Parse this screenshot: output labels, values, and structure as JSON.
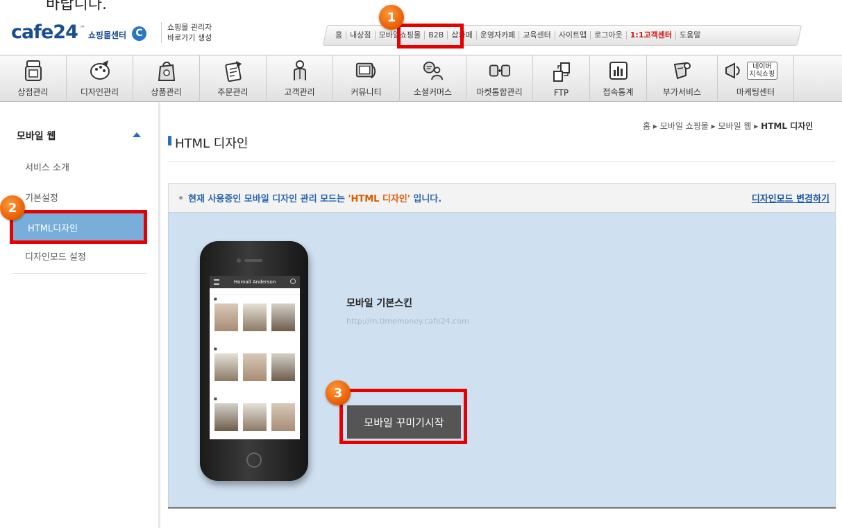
{
  "caption": "바랍니다.",
  "header": {
    "logo_text": "cafe24",
    "logo_tm": "™",
    "logo_sub": "쇼핑몰센터",
    "logo_c": "C",
    "admin_shortcut_line1": "쇼핑몰 관리자",
    "admin_shortcut_line2": "바로가기 생성"
  },
  "topnav": {
    "items": [
      {
        "label": "홈"
      },
      {
        "label": "내상점"
      },
      {
        "label": "모바일쇼핑몰"
      },
      {
        "label": "B2B"
      },
      {
        "label": "샵카페"
      },
      {
        "label": "운영자카페"
      },
      {
        "label": "교육센터"
      },
      {
        "label": "사이트맵"
      },
      {
        "label": "로그아웃"
      },
      {
        "label": "1:1고객센터"
      },
      {
        "label": "도움말"
      }
    ]
  },
  "menu": {
    "items": [
      {
        "label": "상점관리",
        "icon": "store-icon"
      },
      {
        "label": "디자인관리",
        "icon": "palette-icon"
      },
      {
        "label": "상품관리",
        "icon": "bag-icon"
      },
      {
        "label": "주문관리",
        "icon": "order-icon"
      },
      {
        "label": "고객관리",
        "icon": "customer-icon"
      },
      {
        "label": "커뮤니티",
        "icon": "community-icon"
      },
      {
        "label": "소셜커머스",
        "icon": "social-icon"
      },
      {
        "label": "마켓통합관리",
        "icon": "market-icon"
      },
      {
        "label": "FTP",
        "icon": "ftp-icon"
      },
      {
        "label": "접속통계",
        "icon": "stats-icon"
      },
      {
        "label": "부가서비스",
        "icon": "addon-icon"
      },
      {
        "label": "마케팅센터",
        "icon": "marketing-icon",
        "badge_line1": "네이버",
        "badge_line2": "지식쇼핑"
      }
    ]
  },
  "sidebar": {
    "title": "모바일 웹",
    "items": [
      {
        "label": "서비스 소개"
      },
      {
        "label": "기본설정"
      },
      {
        "label": "HTML디자인"
      },
      {
        "label": "디자인모드 설정"
      }
    ]
  },
  "main": {
    "breadcrumb": {
      "home": "홈",
      "sep": "▸",
      "level1": "모바일 쇼핑몰",
      "level2": "모바일 웹",
      "current": "HTML 디자인"
    },
    "page_title": "HTML 디자인",
    "notice_prefix": "현재 사용중인 모바일 디자인 관리 모드는 ",
    "notice_highlight": "'HTML 디자인'",
    "notice_suffix": " 입니다.",
    "change_mode_link": "디자인모드 변경하기",
    "skin_title": "모바일 기본스킨",
    "skin_url": "http://m.timemoney.cafe24.com",
    "start_button": "모바일 꾸미기시작",
    "phone_screen_title": "Hornall Anderson"
  },
  "annotations": {
    "badge1": "1",
    "badge2": "2",
    "badge3": "3",
    "color": "#e60000",
    "badge_color": "#f07a10"
  },
  "colors": {
    "accent_blue": "#2a66b0",
    "sidebar_active": "#79aedb",
    "panel_bg": "#cfe0f0",
    "notice_highlight": "#e05a00",
    "red_nav": "#d5120f"
  }
}
